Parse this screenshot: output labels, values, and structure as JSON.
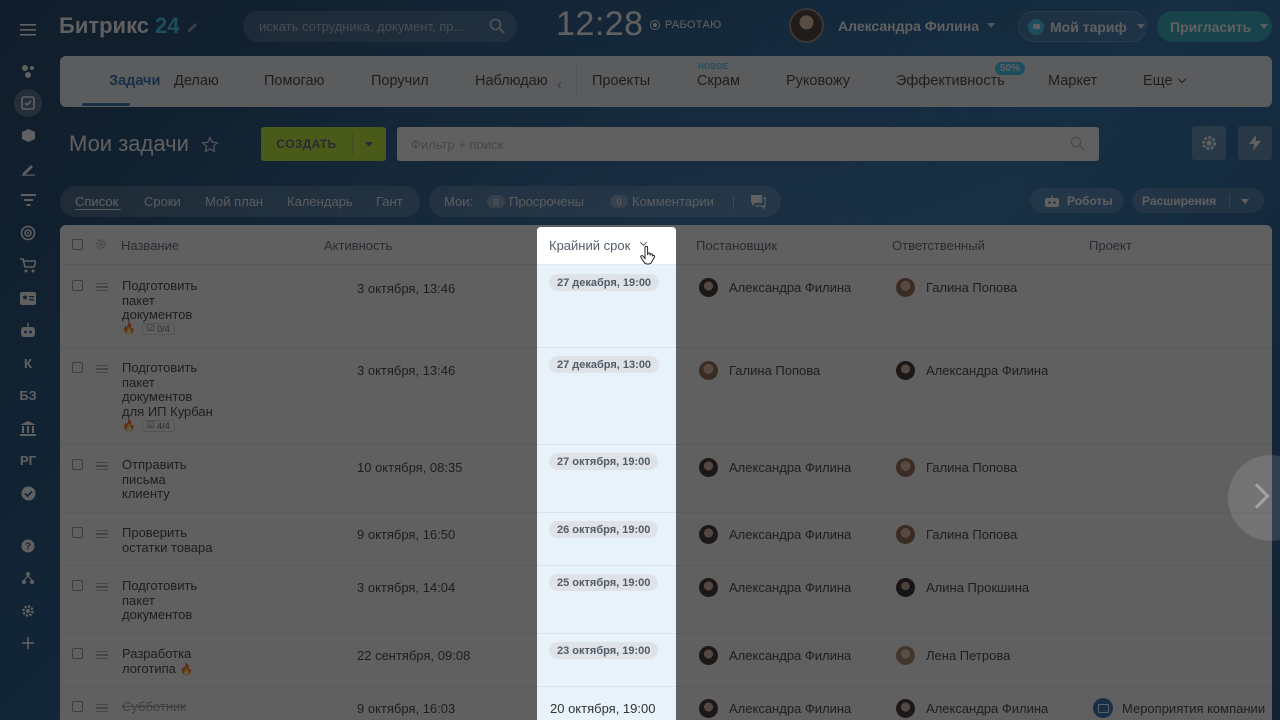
{
  "header": {
    "logo_text": "Битрикс",
    "logo_num": "24",
    "search_placeholder": "искать сотрудника, документ, пр...",
    "clock": "12:28",
    "work_status": "РАБОТАЮ",
    "user_name": "Александра Филина",
    "tariff_label": "Мой тариф",
    "invite_label": "Пригласить"
  },
  "sidebar": {
    "items": [
      {
        "icon": "burger-icon"
      },
      {
        "icon": "feed-icon"
      },
      {
        "icon": "tasks-icon",
        "active": true
      },
      {
        "icon": "box-icon"
      },
      {
        "icon": "sign-icon"
      },
      {
        "icon": "filter-icon"
      },
      {
        "icon": "target-icon"
      },
      {
        "icon": "cart-icon"
      },
      {
        "icon": "contact-card-icon"
      },
      {
        "icon": "robot-icon"
      },
      {
        "label": "К"
      },
      {
        "label": "БЗ"
      },
      {
        "icon": "bank-icon"
      },
      {
        "label": "РГ"
      },
      {
        "icon": "check-circle-icon"
      },
      {
        "icon": "help-icon"
      },
      {
        "icon": "structure-icon"
      },
      {
        "icon": "settings-icon"
      },
      {
        "icon": "plus-icon"
      }
    ]
  },
  "nav": {
    "tabs": [
      "Задачи",
      "Делаю",
      "Помогаю",
      "Поручил",
      "Наблюдаю",
      "Проекты",
      "Скрам",
      "Руковожу",
      "Эффективность",
      "Маркет",
      "Еще"
    ],
    "new_badge": "НОВОЕ",
    "efficiency_badge": "50%"
  },
  "toolbar": {
    "page_title": "Мои задачи",
    "create_label": "СОЗДАТЬ",
    "filter_placeholder": "Фильтр + поиск"
  },
  "views": {
    "tabs": [
      "Список",
      "Сроки",
      "Мой план",
      "Календарь",
      "Гант"
    ],
    "mine_label": "Мои:",
    "overdue_count": "0",
    "overdue_label": "Просрочены",
    "comments_count": "0",
    "comments_label": "Комментарии",
    "robots_label": "Роботы",
    "extensions_label": "Расширения"
  },
  "grid": {
    "columns": [
      "Название",
      "Активность",
      "Крайний срок",
      "Постановщик",
      "Ответственный",
      "Проект"
    ],
    "rows": [
      {
        "name": "Подготовить пакет документов",
        "activity": "3 октября, 13:46",
        "deadline": "27 декабря, 19:00",
        "creator": "Александра Филина",
        "responsible": "Галина Попова",
        "project": "",
        "checklist": "0/4",
        "hot": true
      },
      {
        "name": "Подготовить пакет документов для ИП Курбан",
        "activity": "3 октября, 13:46",
        "deadline": "27 декабря, 13:00",
        "creator": "Галина Попова",
        "responsible": "Александра Филина",
        "project": "",
        "checklist": "4/4",
        "hot": true
      },
      {
        "name": "Отправить письма клиенту",
        "activity": "10 октября, 08:35",
        "deadline": "27 октября, 19:00",
        "creator": "Александра Филина",
        "responsible": "Галина Попова",
        "project": ""
      },
      {
        "name": "Проверить остатки товара",
        "activity": "9 октября, 16:50",
        "deadline": "26 октября, 19:00",
        "creator": "Александра Филина",
        "responsible": "Галина Попова",
        "project": ""
      },
      {
        "name": "Подготовить пакет документов",
        "activity": "3 октября, 14:04",
        "deadline": "25 октября, 19:00",
        "creator": "Александра Филина",
        "responsible": "Алина Прокшина",
        "project": ""
      },
      {
        "name": "Разработка логотипа",
        "activity": "22 сентября, 09:08",
        "deadline": "23 октября, 19:00",
        "creator": "Александра Филина",
        "responsible": "Лена Петрова",
        "project": "",
        "hot": true
      },
      {
        "name": "Субботник",
        "activity": "9 октября, 16:03",
        "deadline": "20 октября, 19:00",
        "creator": "Александра Филина",
        "responsible": "Александра Филина",
        "project": "Мероприятия компании",
        "completed": true
      }
    ]
  },
  "colors": {
    "accent": "#2067b0",
    "create_button": "#bbed21",
    "invite_button": "#1fa5b8",
    "highlight_column": "#e7f2fb"
  }
}
